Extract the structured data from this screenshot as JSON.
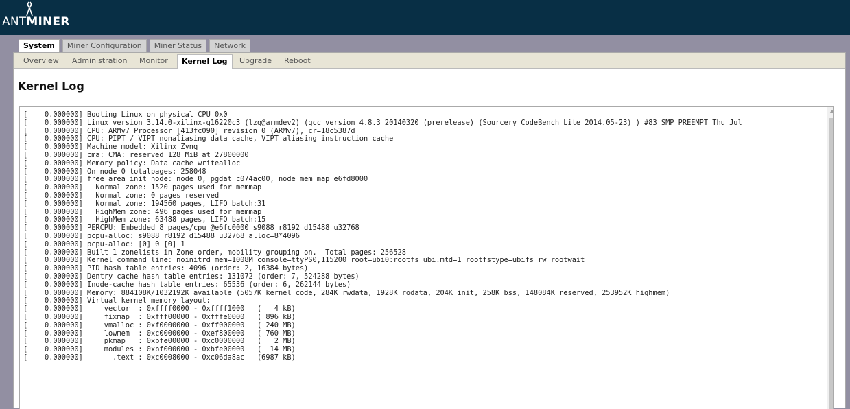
{
  "header": {
    "brand_prefix": "ANT",
    "brand_suffix": "MINER"
  },
  "tabs": [
    {
      "label": "System",
      "active": true
    },
    {
      "label": "Miner Configuration",
      "active": false
    },
    {
      "label": "Miner Status",
      "active": false
    },
    {
      "label": "Network",
      "active": false
    }
  ],
  "subtabs": [
    {
      "label": "Overview",
      "active": false
    },
    {
      "label": "Administration",
      "active": false
    },
    {
      "label": "Monitor",
      "active": false
    },
    {
      "label": "Kernel Log",
      "active": true
    },
    {
      "label": "Upgrade",
      "active": false
    },
    {
      "label": "Reboot",
      "active": false
    }
  ],
  "page": {
    "title": "Kernel Log"
  },
  "log": {
    "text": "[    0.000000] Booting Linux on physical CPU 0x0\n[    0.000000] Linux version 3.14.0-xilinx-g16220c3 (lzq@armdev2) (gcc version 4.8.3 20140320 (prerelease) (Sourcery CodeBench Lite 2014.05-23) ) #83 SMP PREEMPT Thu Jul\n[    0.000000] CPU: ARMv7 Processor [413fc090] revision 0 (ARMv7), cr=18c5387d\n[    0.000000] CPU: PIPT / VIPT nonaliasing data cache, VIPT aliasing instruction cache\n[    0.000000] Machine model: Xilinx Zynq\n[    0.000000] cma: CMA: reserved 128 MiB at 27800000\n[    0.000000] Memory policy: Data cache writealloc\n[    0.000000] On node 0 totalpages: 258048\n[    0.000000] free_area_init_node: node 0, pgdat c074ac00, node_mem_map e6fd8000\n[    0.000000]   Normal zone: 1520 pages used for memmap\n[    0.000000]   Normal zone: 0 pages reserved\n[    0.000000]   Normal zone: 194560 pages, LIFO batch:31\n[    0.000000]   HighMem zone: 496 pages used for memmap\n[    0.000000]   HighMem zone: 63488 pages, LIFO batch:15\n[    0.000000] PERCPU: Embedded 8 pages/cpu @e6fc0000 s9088 r8192 d15488 u32768\n[    0.000000] pcpu-alloc: s9088 r8192 d15488 u32768 alloc=8*4096\n[    0.000000] pcpu-alloc: [0] 0 [0] 1\n[    0.000000] Built 1 zonelists in Zone order, mobility grouping on.  Total pages: 256528\n[    0.000000] Kernel command line: noinitrd mem=1008M console=ttyPS0,115200 root=ubi0:rootfs ubi.mtd=1 rootfstype=ubifs rw rootwait\n[    0.000000] PID hash table entries: 4096 (order: 2, 16384 bytes)\n[    0.000000] Dentry cache hash table entries: 131072 (order: 7, 524288 bytes)\n[    0.000000] Inode-cache hash table entries: 65536 (order: 6, 262144 bytes)\n[    0.000000] Memory: 884108K/1032192K available (5057K kernel code, 284K rwdata, 1928K rodata, 204K init, 258K bss, 148084K reserved, 253952K highmem)\n[    0.000000] Virtual kernel memory layout:\n[    0.000000]     vector  : 0xffff0000 - 0xffff1000   (   4 kB)\n[    0.000000]     fixmap  : 0xfff00000 - 0xfffe0000   ( 896 kB)\n[    0.000000]     vmalloc : 0xf0000000 - 0xff000000   ( 240 MB)\n[    0.000000]     lowmem  : 0xc0000000 - 0xef800000   ( 760 MB)\n[    0.000000]     pkmap   : 0xbfe00000 - 0xc0000000   (   2 MB)\n[    0.000000]     modules : 0xbf000000 - 0xbfe00000   (  14 MB)\n[    0.000000]       .text : 0xc0008000 - 0xc06da8ac   (6987 kB)"
  },
  "colors": {
    "header_bg": "#082f45",
    "page_bg": "#928fa2",
    "subnav_bg": "#e8e5d6"
  },
  "icons": {
    "logo": "antminer-logo-icon",
    "scroll_up": "scroll-up-arrow-icon"
  }
}
